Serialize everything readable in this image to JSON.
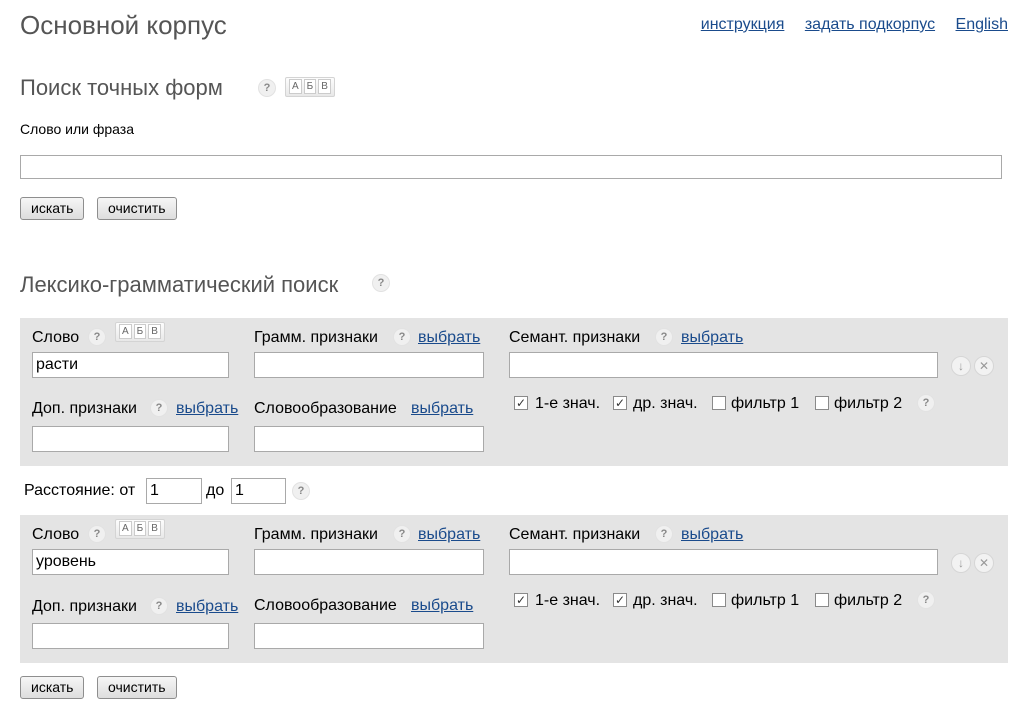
{
  "header": {
    "title": "Основной корпус",
    "links": {
      "instruction": "инструкция",
      "subcorpus": "задать подкорпус",
      "english": "English"
    }
  },
  "exact": {
    "title": "Поиск точных форм",
    "field_label": "Слово или фраза",
    "value": "",
    "search_label": "искать",
    "clear_label": "очистить"
  },
  "lexgram": {
    "title": "Лексико-грамматический поиск"
  },
  "common": {
    "help": "?",
    "kbd": [
      "А",
      "Б",
      "В"
    ],
    "gram_label": "Грамм. признаки",
    "sem_label": "Семант. признаки",
    "add_label": "Доп. признаки",
    "deriv_label": "Словообразование",
    "choose": "выбрать",
    "word_label": "Слово",
    "cb1": "1-е знач.",
    "cb2": "др. знач.",
    "cb3": "фильтр 1",
    "cb4": "фильтр 2"
  },
  "word1": {
    "value": "расти",
    "cb1": true,
    "cb2": true,
    "cb3": false,
    "cb4": false
  },
  "word2": {
    "value": "уровень",
    "cb1": true,
    "cb2": true,
    "cb3": false,
    "cb4": false
  },
  "distance": {
    "label": "Расстояние: от",
    "from": "1",
    "to_label": "до",
    "to": "1"
  },
  "bottom": {
    "search_label": "искать",
    "clear_label": "очистить"
  }
}
